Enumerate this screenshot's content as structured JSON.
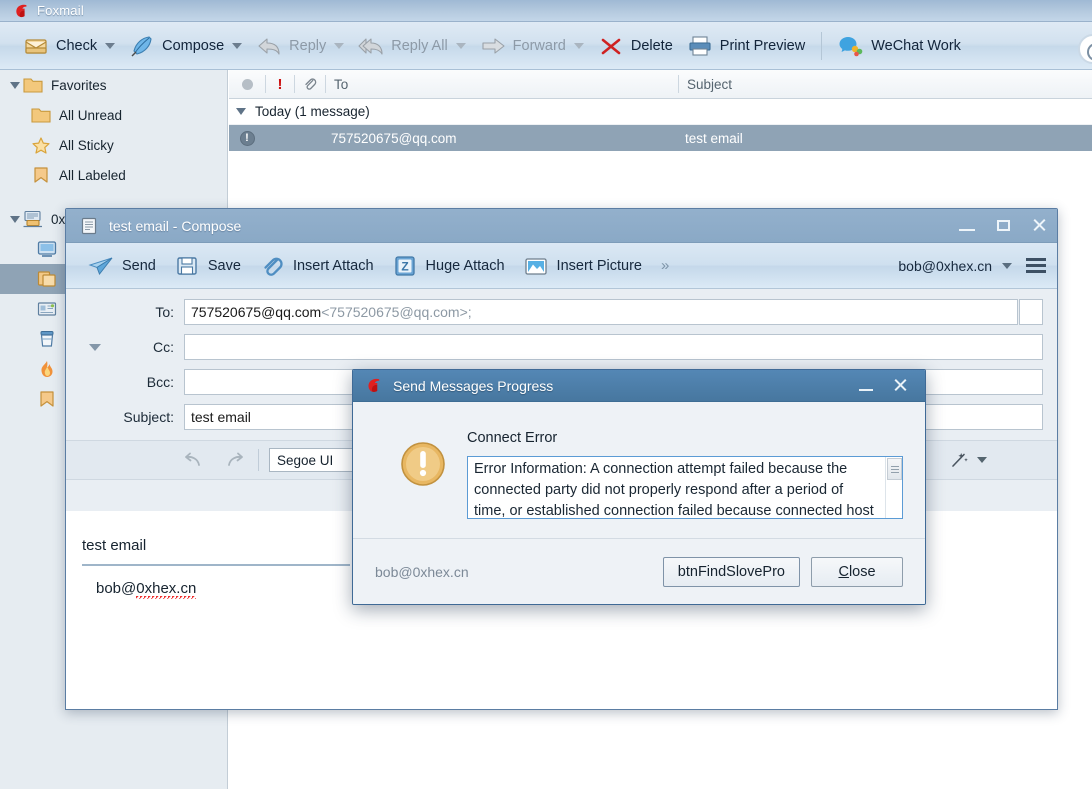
{
  "app": {
    "title": "Foxmail",
    "logo_icon": "foxmail-logo-icon"
  },
  "toolbar": {
    "items": [
      {
        "label": "Check",
        "icon": "inbox-tray-icon",
        "caret": true,
        "dim": false
      },
      {
        "label": "Compose",
        "icon": "quill-feather-icon",
        "caret": true,
        "dim": false
      },
      {
        "label": "Reply",
        "icon": "reply-arrow-icon",
        "caret": true,
        "dim": true
      },
      {
        "label": "Reply All",
        "icon": "reply-all-icon",
        "caret": true,
        "dim": true
      },
      {
        "label": "Forward",
        "icon": "forward-arrow-icon",
        "caret": true,
        "dim": true
      },
      {
        "label": "Delete",
        "icon": "delete-x-icon",
        "caret": false,
        "dim": false
      },
      {
        "label": "Print Preview",
        "icon": "printer-icon",
        "caret": false,
        "dim": false
      },
      {
        "label": "WeChat Work",
        "icon": "wechat-work-icon",
        "caret": false,
        "dim": false
      }
    ],
    "edge_icon": "circular-progress-icon"
  },
  "sidebar": {
    "items": [
      {
        "label": "Favorites",
        "icon": "folder-icon",
        "indent": 0,
        "expander": true,
        "selected": false
      },
      {
        "label": "All Unread",
        "icon": "folder-icon",
        "indent": 1,
        "expander": false,
        "selected": false
      },
      {
        "label": "All Sticky",
        "icon": "star-icon",
        "indent": 1,
        "expander": false,
        "selected": false
      },
      {
        "label": "All Labeled",
        "icon": "bookmark-icon",
        "indent": 1,
        "expander": false,
        "selected": false
      },
      {
        "label": "0x",
        "icon": "account-mail-icon",
        "indent": 0,
        "expander": true,
        "selected": false
      },
      {
        "label": "",
        "icon": "inbox-screen-icon",
        "indent": 1,
        "expander": false,
        "selected": false
      },
      {
        "label": "",
        "icon": "drafts-copy-icon",
        "indent": 1,
        "expander": false,
        "selected": true
      },
      {
        "label": "",
        "icon": "sent-card-icon",
        "indent": 1,
        "expander": false,
        "selected": false
      },
      {
        "label": "",
        "icon": "trash-bin-icon",
        "indent": 1,
        "expander": false,
        "selected": false
      },
      {
        "label": "",
        "icon": "junk-flame-icon",
        "indent": 1,
        "expander": false,
        "selected": false
      },
      {
        "label": "",
        "icon": "bookmark-icon",
        "indent": 1,
        "expander": false,
        "selected": false
      }
    ]
  },
  "message_list": {
    "columns": {
      "status_icon": "gray-dot-icon",
      "priority_icon": "exclamation-icon",
      "attachment_icon": "paperclip-icon",
      "to": "To",
      "subject": "Subject"
    },
    "group_header": "Today (1 message)",
    "rows": [
      {
        "status_icon": "error-circle-icon",
        "to": "757520675@qq.com",
        "subject": "test email",
        "selected": true
      }
    ]
  },
  "compose": {
    "title": "test email - Compose",
    "title_icon": "document-icon",
    "window_buttons": {
      "minimize": "minimize-icon",
      "maximize": "maximize-icon",
      "close": "close-icon"
    },
    "toolbar": [
      {
        "label": "Send",
        "icon": "paper-plane-icon"
      },
      {
        "label": "Save",
        "icon": "floppy-disk-icon"
      },
      {
        "label": "Insert Attach",
        "icon": "paperclip-icon"
      },
      {
        "label": "Huge Attach",
        "icon": "huge-attach-z-icon"
      },
      {
        "label": "Insert Picture",
        "icon": "picture-icon"
      }
    ],
    "overflow": "»",
    "account": "bob@0xhex.cn",
    "account_caret_icon": "chevron-down-icon",
    "menu_icon": "list-menu-icon",
    "fields": {
      "to_label": "To:",
      "to_value": "757520675@qq.com",
      "to_value_dim": "<757520675@qq.com>;",
      "cc_label": "Cc:",
      "cc_value": "",
      "bcc_label": "Bcc:",
      "bcc_value": "",
      "subject_label": "Subject:",
      "subject_value": "test email",
      "expander_icon": "triangle-down-icon"
    },
    "format_bar": {
      "undo_icon": "undo-arrow-icon",
      "redo_icon": "redo-arrow-icon",
      "font_family": "Segoe UI",
      "wand_icon": "magic-wand-icon",
      "wand_caret_icon": "chevron-down-icon"
    },
    "body": {
      "line1": "test email",
      "line2_plain": "bob@",
      "line2_misspelled": "0xhex.cn"
    }
  },
  "dialog": {
    "title": "Send Messages Progress",
    "title_icon": "foxmail-logo-icon",
    "minimize_icon": "minimize-icon",
    "close_icon": "close-icon",
    "warning_icon": "warning-exclamation-icon",
    "heading": "Connect Error",
    "error_text": "Error Information: A connection attempt failed because the connected party did not properly respond after a period of time, or established connection failed because connected host has failed to respond",
    "account": "bob@0xhex.cn",
    "buttons": {
      "find_solve": "btnFindSlovePro",
      "close_prefix": "C",
      "close_rest": "lose"
    },
    "scrollbar_icon": "scrollbar-thumb-icon"
  },
  "colors": {
    "main_titlebar": "#b5cadf",
    "compose_titlebar": "#8aa9c6",
    "dialog_titlebar": "#47779f",
    "selection": "#8fa3b5",
    "sidebar_bg": "#e6ecf1",
    "accent_red": "#cc1111",
    "warning_amber": "#e0ab4e"
  }
}
